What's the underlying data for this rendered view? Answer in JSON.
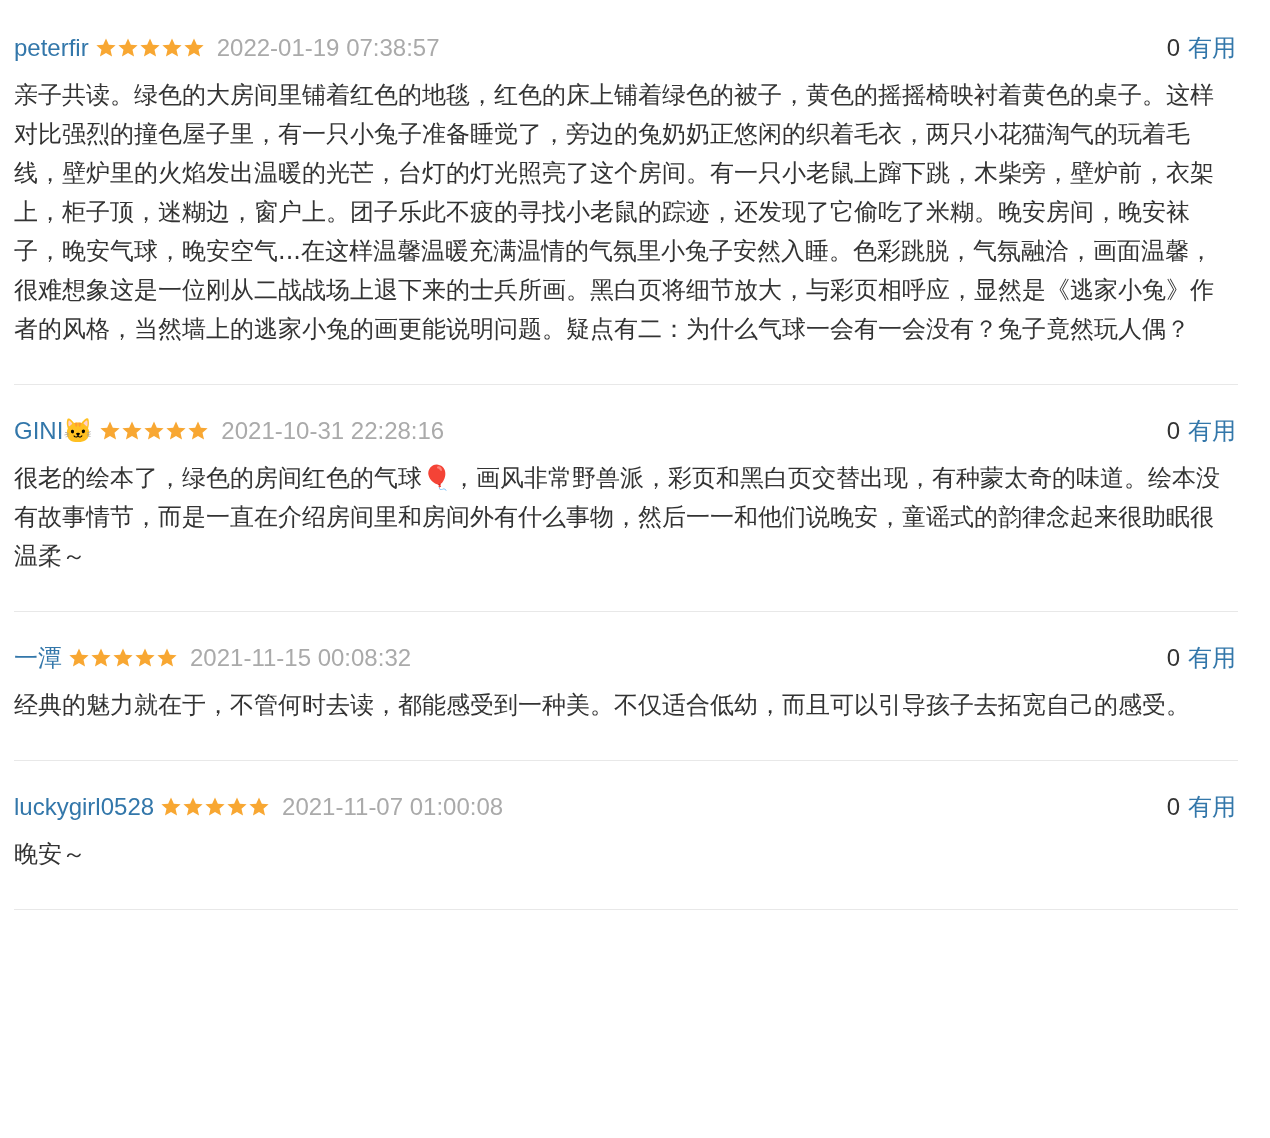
{
  "reviews": [
    {
      "user": "peterfir",
      "stars": 5,
      "time": "2022-01-19 07:38:57",
      "votes": "0",
      "vote_label": "有用",
      "text": "亲子共读。绿色的大房间里铺着红色的地毯，红色的床上铺着绿色的被子，黄色的摇摇椅映衬着黄色的桌子。这样对比强烈的撞色屋子里，有一只小兔子准备睡觉了，旁边的兔奶奶正悠闲的织着毛衣，两只小花猫淘气的玩着毛线，壁炉里的火焰发出温暖的光芒，台灯的灯光照亮了这个房间。有一只小老鼠上蹿下跳，木柴旁，壁炉前，衣架上，柜子顶，迷糊边，窗户上。团子乐此不疲的寻找小老鼠的踪迹，还发现了它偷吃了米糊。晚安房间，晚安袜子，晚安气球，晚安空气...在这样温馨温暖充满温情的气氛里小兔子安然入睡。色彩跳脱，气氛融洽，画面温馨，很难想象这是一位刚从二战战场上退下来的士兵所画。黑白页将细节放大，与彩页相呼应，显然是《逃家小兔》作者的风格，当然墙上的逃家小兔的画更能说明问题。疑点有二：为什么气球一会有一会没有？兔子竟然玩人偶？"
    },
    {
      "user": "GINI🐱",
      "stars": 5,
      "time": "2021-10-31 22:28:16",
      "votes": "0",
      "vote_label": "有用",
      "text": "很老的绘本了，绿色的房间红色的气球🎈，画风非常野兽派，彩页和黑白页交替出现，有种蒙太奇的味道。绘本没有故事情节，而是一直在介绍房间里和房间外有什么事物，然后一一和他们说晚安，童谣式的韵律念起来很助眠很温柔～"
    },
    {
      "user": "一潭",
      "stars": 5,
      "time": "2021-11-15 00:08:32",
      "votes": "0",
      "vote_label": "有用",
      "text": "经典的魅力就在于，不管何时去读，都能感受到一种美。不仅适合低幼，而且可以引导孩子去拓宽自己的感受。"
    },
    {
      "user": "luckygirl0528",
      "stars": 5,
      "time": "2021-11-07 01:00:08",
      "votes": "0",
      "vote_label": "有用",
      "text": "晚安～"
    }
  ]
}
